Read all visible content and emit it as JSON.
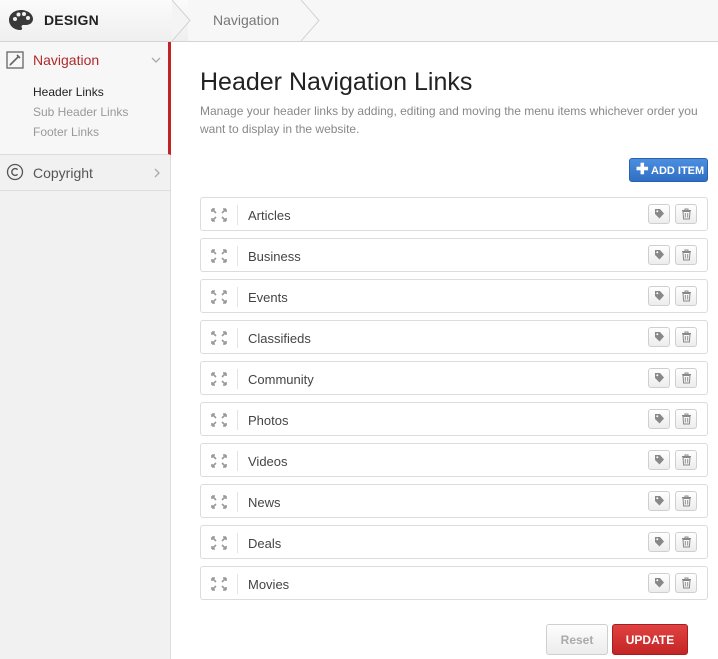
{
  "topbar": {
    "brand": "DESIGN",
    "brand_icon": "palette-icon",
    "breadcrumb": "Navigation"
  },
  "sidebar": {
    "sections": [
      {
        "label": "Navigation",
        "icon": "brush-icon",
        "expanded": true,
        "items": [
          "Header Links",
          "Sub Header Links",
          "Footer Links"
        ],
        "active_item": "Header Links"
      },
      {
        "label": "Copyright",
        "icon": "copyright-icon",
        "expanded": false
      }
    ]
  },
  "main": {
    "title": "Header Navigation Links",
    "description": "Manage your header links by adding, editing and moving the menu items whichever order you want to display in the website.",
    "add_button": "ADD ITEM",
    "links": [
      "Articles",
      "Business",
      "Events",
      "Classifieds",
      "Community",
      "Photos",
      "Videos",
      "News",
      "Deals",
      "Movies"
    ],
    "reset_button": "Reset",
    "update_button": "UPDATE"
  },
  "colors": {
    "accent_red": "#c42626",
    "primary_blue": "#2f6fc4",
    "active_nav_text": "#b02a2a"
  }
}
